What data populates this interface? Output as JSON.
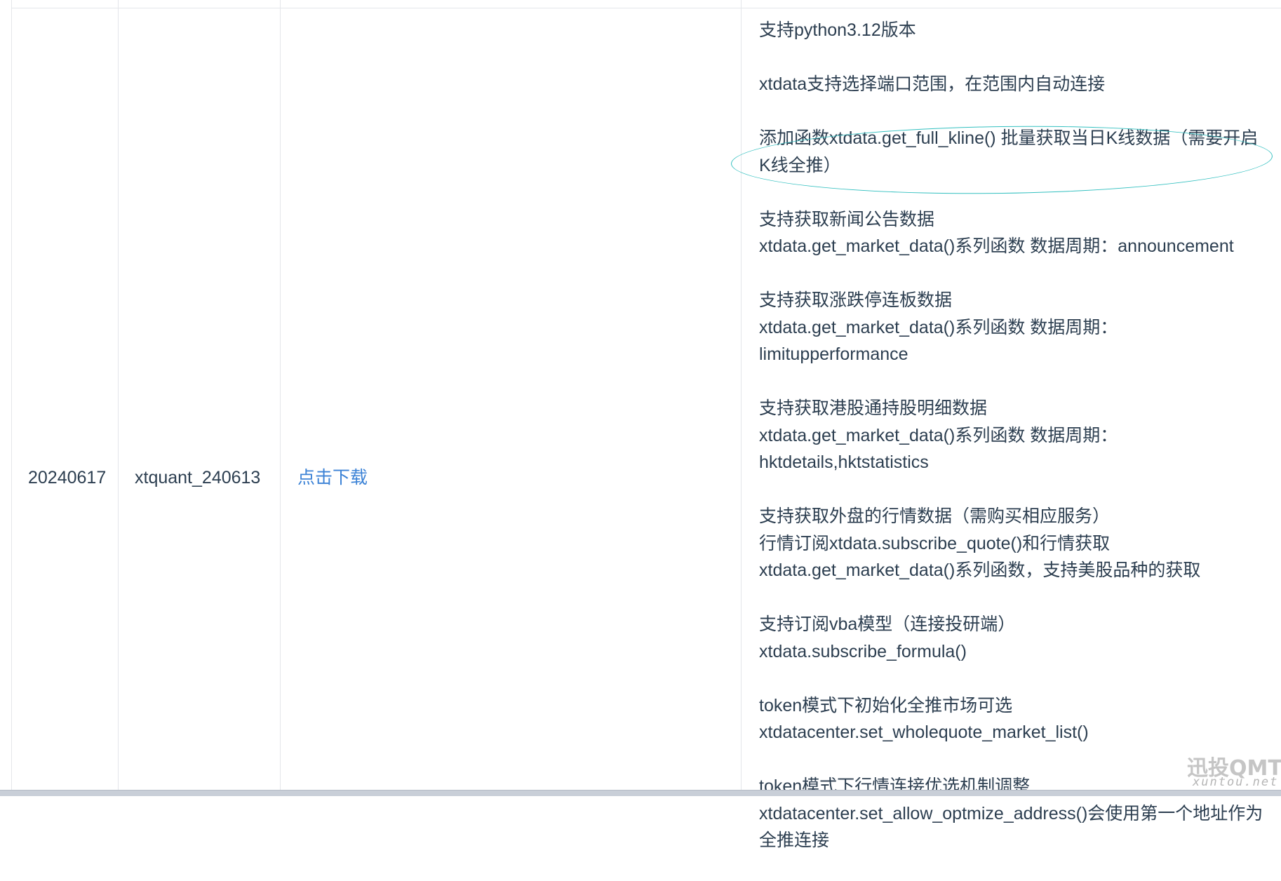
{
  "table": {
    "row": {
      "date": "20240617",
      "version": "xtquant_240613",
      "download_label": "点击下载",
      "notes": [
        {
          "lines": [
            "支持python3.12版本"
          ]
        },
        {
          "lines": [
            "xtdata支持选择端口范围，在范围内自动连接"
          ]
        },
        {
          "lines": [
            "添加函数xtdata.get_full_kline() 批量获取当日K线数据（需要开启K线全推）"
          ]
        },
        {
          "lines": [
            "支持获取新闻公告数据",
            "xtdata.get_market_data()系列函数 数据周期：announcement"
          ]
        },
        {
          "lines": [
            "支持获取涨跌停连板数据",
            "xtdata.get_market_data()系列函数 数据周期：limitupperformance"
          ]
        },
        {
          "lines": [
            "支持获取港股通持股明细数据",
            "xtdata.get_market_data()系列函数 数据周期：hktdetails,hktstatistics"
          ]
        },
        {
          "lines": [
            "支持获取外盘的行情数据（需购买相应服务）",
            "行情订阅xtdata.subscribe_quote()和行情获取",
            "xtdata.get_market_data()系列函数，支持美股品种的获取"
          ]
        },
        {
          "lines": [
            "支持订阅vba模型（连接投研端）",
            "xtdata.subscribe_formula()"
          ]
        },
        {
          "lines": [
            "token模式下初始化全推市场可选",
            "xtdatacenter.set_wholequote_market_list()"
          ]
        },
        {
          "lines": [
            "token模式下行情连接优选机制调整",
            "xtdatacenter.set_allow_optmize_address()会使用第一个地址作为全推连接"
          ]
        }
      ]
    }
  },
  "watermark": {
    "logo": "迅投QMT",
    "url": "xuntou.net"
  },
  "colors": {
    "link": "#3b82d6",
    "text": "#2c3e50",
    "border": "#e4e6ea",
    "annotation": "#33c0c0"
  }
}
